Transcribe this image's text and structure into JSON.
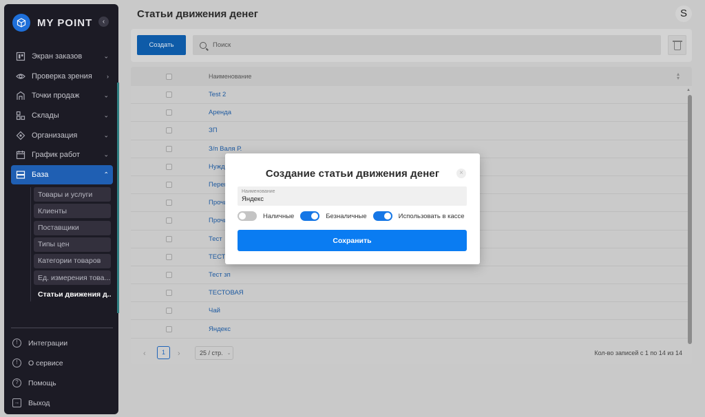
{
  "app": {
    "logo_text": "MY POINT"
  },
  "sidebar": {
    "items": [
      {
        "label": "Экран заказов",
        "icon": "layout-icon"
      },
      {
        "label": "Проверка зрения",
        "icon": "eye-icon"
      },
      {
        "label": "Точки продаж",
        "icon": "store-icon"
      },
      {
        "label": "Склады",
        "icon": "warehouse-icon"
      },
      {
        "label": "Организация",
        "icon": "organization-icon"
      },
      {
        "label": "График работ",
        "icon": "calendar-icon"
      },
      {
        "label": "База",
        "icon": "database-icon"
      }
    ],
    "submenu": [
      "Товары и услуги",
      "Клиенты",
      "Поставщики",
      "Типы цен",
      "Категории товаров",
      "Ед. измерения това...",
      "Статьи движения д..."
    ],
    "bottom": [
      {
        "label": "Интеграции",
        "icon": "info-icon"
      },
      {
        "label": "О сервисе",
        "icon": "info-icon"
      },
      {
        "label": "Помощь",
        "icon": "help-icon"
      },
      {
        "label": "Выход",
        "icon": "logout-icon"
      }
    ]
  },
  "header": {
    "title": "Статьи движения денег",
    "avatar_letter": "S"
  },
  "toolbar": {
    "create_label": "Создать",
    "search_placeholder": "Поиск"
  },
  "table": {
    "column": "Наименование",
    "rows": [
      "Test 2",
      "Аренда",
      "ЗП",
      "З/п Валя Р.",
      "Нужды",
      "Перево...",
      "Прочи...",
      "Прочи...",
      "Тест",
      "ТЕСТ",
      "Тест зп",
      "ТЕСТОВАЯ",
      "Чай",
      "Яндекс"
    ]
  },
  "pager": {
    "current_page": "1",
    "per_page": "25 / стр.",
    "records": "Кол-во записей с 1 по 14 из 14"
  },
  "modal": {
    "title": "Создание статьи движения денег",
    "field_label": "Наименование",
    "field_value": "Яндекс",
    "toggle_cash": "Наличные",
    "toggle_cashless": "Безналичные",
    "toggle_register": "Использовать в кассе",
    "save_label": "Сохранить"
  },
  "colors": {
    "primary": "#0a7cf2",
    "sidebar_bg": "#1c1b25",
    "active_item": "#1f5fb3"
  }
}
